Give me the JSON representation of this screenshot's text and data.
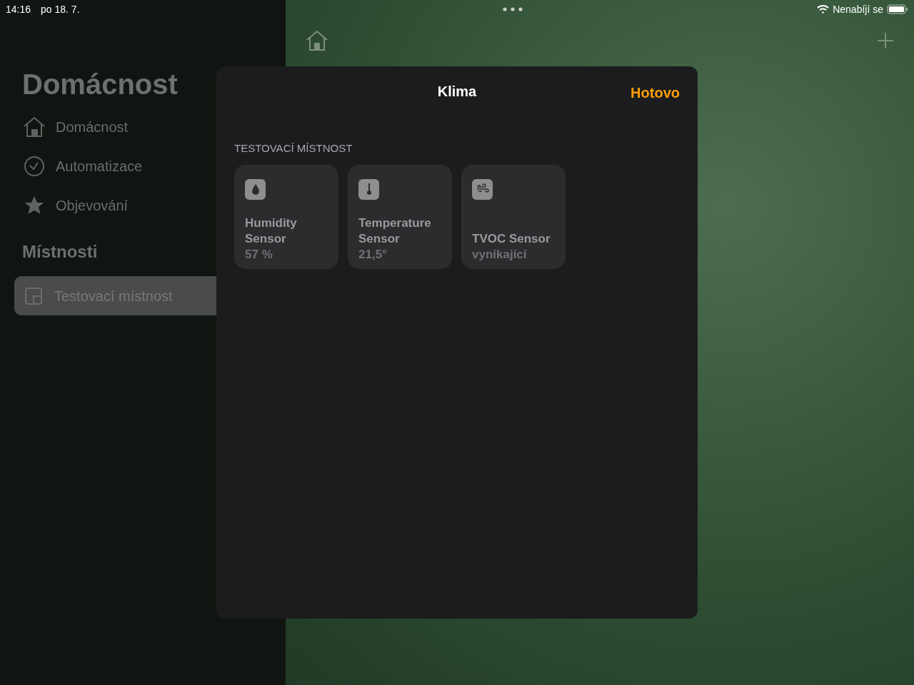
{
  "status_bar": {
    "time": "14:16",
    "date": "po 18. 7.",
    "charging": "Nenabíjí se"
  },
  "sidebar": {
    "title": "Domácnost",
    "items": [
      {
        "kind": "home",
        "label": "Domácnost",
        "selected": false
      },
      {
        "kind": "automation",
        "label": "Automatizace",
        "selected": false
      },
      {
        "kind": "discover",
        "label": "Objevování",
        "selected": false
      }
    ],
    "rooms_heading": "Místnosti",
    "rooms": [
      {
        "label": "Testovací místnost",
        "selected": true
      }
    ]
  },
  "sheet": {
    "title": "Klima",
    "done": "Hotovo",
    "section": "TESTOVACÍ MÍSTNOST",
    "tiles": [
      {
        "kind": "humidity",
        "name": "Humidity Sensor",
        "value": "57 %"
      },
      {
        "kind": "temperature",
        "name": "Temperature Sensor",
        "value": "21,5°"
      },
      {
        "kind": "air",
        "name": "TVOC Sensor",
        "value": "vynikající"
      }
    ]
  }
}
